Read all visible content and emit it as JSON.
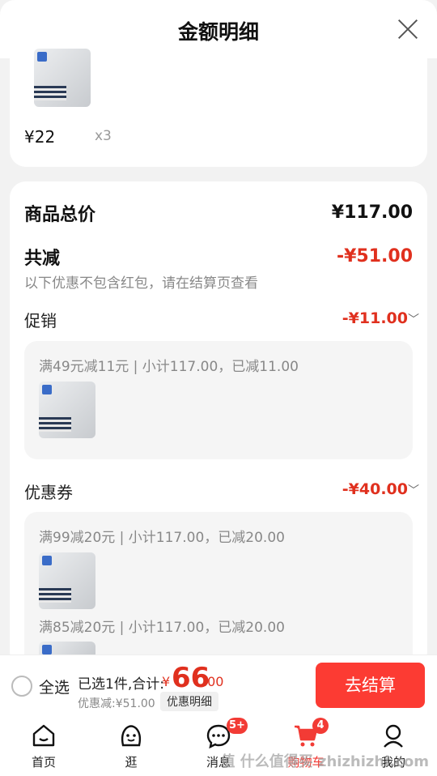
{
  "header": {
    "title": "金额明细"
  },
  "item": {
    "price": "¥22",
    "qty": "x3"
  },
  "summary": {
    "total_label": "商品总价",
    "total_value": "¥117.00",
    "reduce_label": "共减",
    "reduce_value": "-¥51.00",
    "note": "以下优惠不包含红包，请在结算页查看"
  },
  "promo": {
    "label": "促销",
    "value": "-¥11.00",
    "line": "满49元减11元 | 小计117.00，已减11.00"
  },
  "coupon": {
    "label": "优惠券",
    "value": "-¥40.00",
    "line1": "满99减20元 | 小计117.00，已减20.00",
    "line2": "满85减20元 | 小计117.00，已减20.00"
  },
  "bottom": {
    "select_all": "全选",
    "selected": "已选1件,合计:",
    "currency": "¥",
    "amount_int": "66",
    "amount_dec": ".00",
    "discount": "优惠减:¥51.00",
    "detail_btn": "优惠明细",
    "checkout": "去结算"
  },
  "tabs": [
    {
      "label": "首页",
      "icon": "home-icon"
    },
    {
      "label": "逛",
      "icon": "smile-icon"
    },
    {
      "label": "消息",
      "icon": "message-icon",
      "badge": "5+"
    },
    {
      "label": "购物车",
      "icon": "cart-icon",
      "badge": "4"
    },
    {
      "label": "我的",
      "icon": "user-icon"
    }
  ],
  "watermark": "值 什么值得买 zhizhizhi.com",
  "colors": {
    "accent": "#e0301e",
    "checkout": "#fc3b33"
  }
}
